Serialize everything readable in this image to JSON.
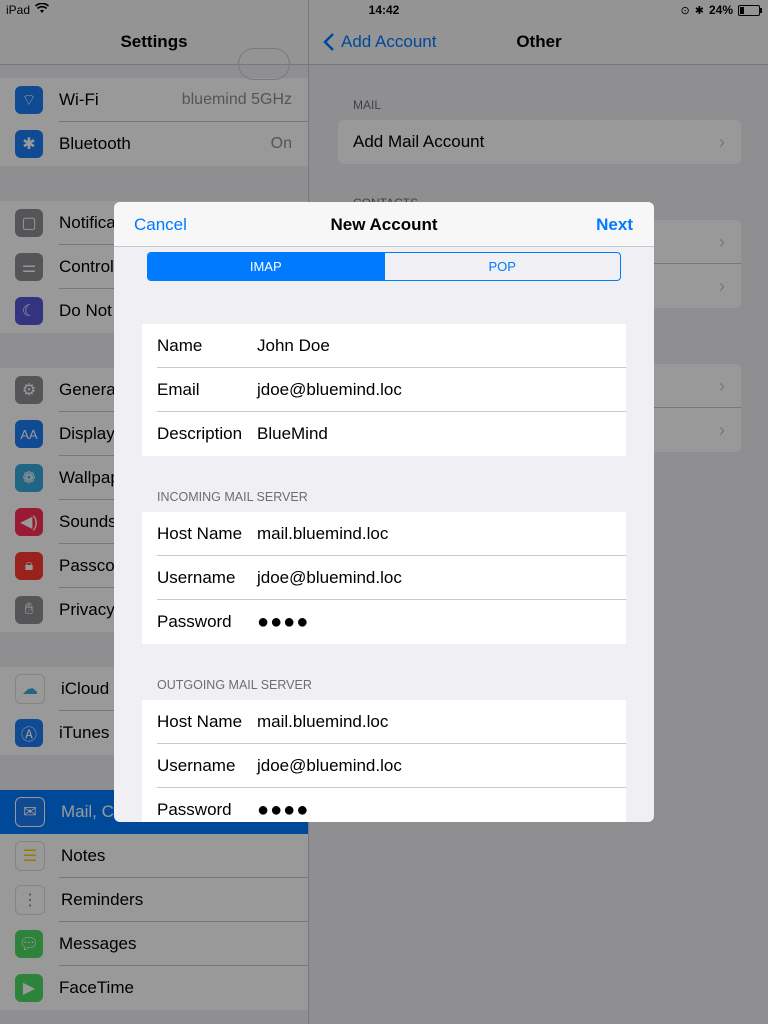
{
  "status": {
    "device": "iPad",
    "time": "14:42",
    "battery": "24%",
    "battery_level": 0.24
  },
  "master": {
    "title": "Settings",
    "groups": [
      {
        "rows": [
          {
            "label": "Wi-Fi",
            "value": "bluemind 5GHz",
            "icon": "wifi-icon",
            "color": "#1a7cf5"
          },
          {
            "label": "Bluetooth",
            "value": "On",
            "icon": "bluetooth-icon",
            "color": "#1a7cf5"
          }
        ]
      },
      {
        "rows": [
          {
            "label": "Notifica",
            "icon": "notifications-icon",
            "color": "#8e8e93"
          },
          {
            "label": "Control",
            "icon": "control-center-icon",
            "color": "#8e8e93"
          },
          {
            "label": "Do Not",
            "icon": "moon-icon",
            "color": "#5856d6"
          }
        ]
      },
      {
        "rows": [
          {
            "label": "Genera",
            "icon": "gear-icon",
            "color": "#8e8e93"
          },
          {
            "label": "Display",
            "icon": "display-icon",
            "color": "#1a7cf5"
          },
          {
            "label": "Wallpap",
            "icon": "wallpaper-icon",
            "color": "#36aadc"
          },
          {
            "label": "Sounds",
            "icon": "sounds-icon",
            "color": "#ff2d55"
          },
          {
            "label": "Passco",
            "icon": "lock-icon",
            "color": "#ff3b30"
          },
          {
            "label": "Privacy",
            "icon": "hand-icon",
            "color": "#8e8e93"
          }
        ]
      },
      {
        "rows": [
          {
            "label": "iCloud",
            "icon": "cloud-icon",
            "color": "#ffffff"
          },
          {
            "label": "iTunes",
            "icon": "app-store-icon",
            "color": "#1a7cf5"
          }
        ]
      },
      {
        "rows": [
          {
            "label": "Mail, C",
            "icon": "mail-icon",
            "color": "#1a7cf5",
            "selected": true
          },
          {
            "label": "Notes",
            "icon": "notes-icon",
            "color": "#ffcc00"
          },
          {
            "label": "Reminders",
            "icon": "reminders-icon",
            "color": "#ffffff"
          },
          {
            "label": "Messages",
            "icon": "messages-icon",
            "color": "#4cd964"
          },
          {
            "label": "FaceTime",
            "icon": "facetime-icon",
            "color": "#4cd964"
          }
        ]
      }
    ]
  },
  "detail": {
    "back_label": "Add Account",
    "title": "Other",
    "mail_header": "MAIL",
    "add_mail_label": "Add Mail Account",
    "contacts_header": "CONTACTS"
  },
  "modal": {
    "cancel_label": "Cancel",
    "title": "New Account",
    "next_label": "Next",
    "segments": [
      "IMAP",
      "POP"
    ],
    "account": [
      {
        "key": "Name",
        "value": "John Doe"
      },
      {
        "key": "Email",
        "value": "jdoe@bluemind.loc"
      },
      {
        "key": "Description",
        "value": "BlueMind"
      }
    ],
    "incoming_header": "INCOMING MAIL SERVER",
    "incoming": [
      {
        "key": "Host Name",
        "value": "mail.bluemind.loc"
      },
      {
        "key": "Username",
        "value": "jdoe@bluemind.loc"
      },
      {
        "key": "Password",
        "value": "●●●●"
      }
    ],
    "outgoing_header": "OUTGOING MAIL SERVER",
    "outgoing": [
      {
        "key": "Host Name",
        "value": "mail.bluemind.loc"
      },
      {
        "key": "Username",
        "value": "jdoe@bluemind.loc"
      },
      {
        "key": "Password",
        "value": "●●●●"
      }
    ]
  }
}
